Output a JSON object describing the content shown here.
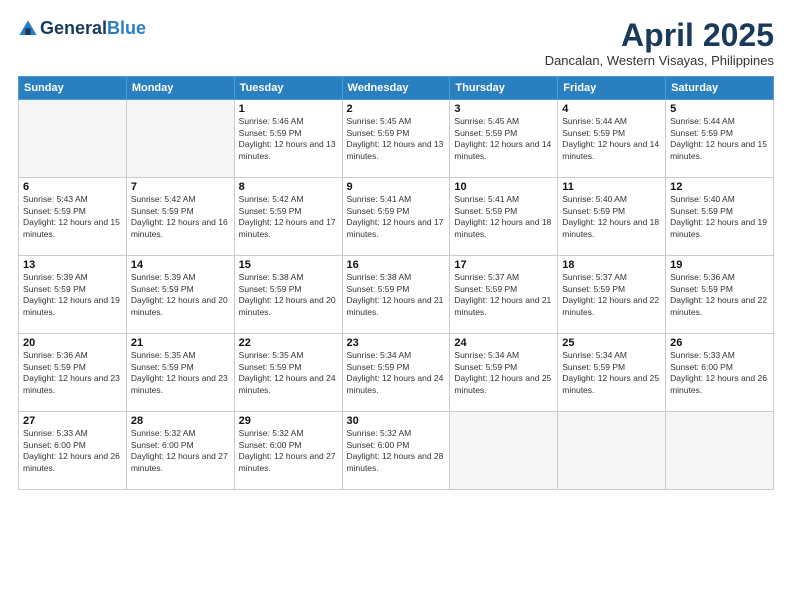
{
  "logo": {
    "general": "General",
    "blue": "Blue"
  },
  "title": "April 2025",
  "location": "Dancalan, Western Visayas, Philippines",
  "days_of_week": [
    "Sunday",
    "Monday",
    "Tuesday",
    "Wednesday",
    "Thursday",
    "Friday",
    "Saturday"
  ],
  "weeks": [
    [
      {
        "day": "",
        "empty": true
      },
      {
        "day": "",
        "empty": true
      },
      {
        "day": "1",
        "sunrise": "5:46 AM",
        "sunset": "5:59 PM",
        "daylight": "12 hours and 13 minutes."
      },
      {
        "day": "2",
        "sunrise": "5:45 AM",
        "sunset": "5:59 PM",
        "daylight": "12 hours and 13 minutes."
      },
      {
        "day": "3",
        "sunrise": "5:45 AM",
        "sunset": "5:59 PM",
        "daylight": "12 hours and 14 minutes."
      },
      {
        "day": "4",
        "sunrise": "5:44 AM",
        "sunset": "5:59 PM",
        "daylight": "12 hours and 14 minutes."
      },
      {
        "day": "5",
        "sunrise": "5:44 AM",
        "sunset": "5:59 PM",
        "daylight": "12 hours and 15 minutes."
      }
    ],
    [
      {
        "day": "6",
        "sunrise": "5:43 AM",
        "sunset": "5:59 PM",
        "daylight": "12 hours and 15 minutes."
      },
      {
        "day": "7",
        "sunrise": "5:42 AM",
        "sunset": "5:59 PM",
        "daylight": "12 hours and 16 minutes."
      },
      {
        "day": "8",
        "sunrise": "5:42 AM",
        "sunset": "5:59 PM",
        "daylight": "12 hours and 17 minutes."
      },
      {
        "day": "9",
        "sunrise": "5:41 AM",
        "sunset": "5:59 PM",
        "daylight": "12 hours and 17 minutes."
      },
      {
        "day": "10",
        "sunrise": "5:41 AM",
        "sunset": "5:59 PM",
        "daylight": "12 hours and 18 minutes."
      },
      {
        "day": "11",
        "sunrise": "5:40 AM",
        "sunset": "5:59 PM",
        "daylight": "12 hours and 18 minutes."
      },
      {
        "day": "12",
        "sunrise": "5:40 AM",
        "sunset": "5:59 PM",
        "daylight": "12 hours and 19 minutes."
      }
    ],
    [
      {
        "day": "13",
        "sunrise": "5:39 AM",
        "sunset": "5:59 PM",
        "daylight": "12 hours and 19 minutes."
      },
      {
        "day": "14",
        "sunrise": "5:39 AM",
        "sunset": "5:59 PM",
        "daylight": "12 hours and 20 minutes."
      },
      {
        "day": "15",
        "sunrise": "5:38 AM",
        "sunset": "5:59 PM",
        "daylight": "12 hours and 20 minutes."
      },
      {
        "day": "16",
        "sunrise": "5:38 AM",
        "sunset": "5:59 PM",
        "daylight": "12 hours and 21 minutes."
      },
      {
        "day": "17",
        "sunrise": "5:37 AM",
        "sunset": "5:59 PM",
        "daylight": "12 hours and 21 minutes."
      },
      {
        "day": "18",
        "sunrise": "5:37 AM",
        "sunset": "5:59 PM",
        "daylight": "12 hours and 22 minutes."
      },
      {
        "day": "19",
        "sunrise": "5:36 AM",
        "sunset": "5:59 PM",
        "daylight": "12 hours and 22 minutes."
      }
    ],
    [
      {
        "day": "20",
        "sunrise": "5:36 AM",
        "sunset": "5:59 PM",
        "daylight": "12 hours and 23 minutes."
      },
      {
        "day": "21",
        "sunrise": "5:35 AM",
        "sunset": "5:59 PM",
        "daylight": "12 hours and 23 minutes."
      },
      {
        "day": "22",
        "sunrise": "5:35 AM",
        "sunset": "5:59 PM",
        "daylight": "12 hours and 24 minutes."
      },
      {
        "day": "23",
        "sunrise": "5:34 AM",
        "sunset": "5:59 PM",
        "daylight": "12 hours and 24 minutes."
      },
      {
        "day": "24",
        "sunrise": "5:34 AM",
        "sunset": "5:59 PM",
        "daylight": "12 hours and 25 minutes."
      },
      {
        "day": "25",
        "sunrise": "5:34 AM",
        "sunset": "5:59 PM",
        "daylight": "12 hours and 25 minutes."
      },
      {
        "day": "26",
        "sunrise": "5:33 AM",
        "sunset": "6:00 PM",
        "daylight": "12 hours and 26 minutes."
      }
    ],
    [
      {
        "day": "27",
        "sunrise": "5:33 AM",
        "sunset": "6:00 PM",
        "daylight": "12 hours and 26 minutes."
      },
      {
        "day": "28",
        "sunrise": "5:32 AM",
        "sunset": "6:00 PM",
        "daylight": "12 hours and 27 minutes."
      },
      {
        "day": "29",
        "sunrise": "5:32 AM",
        "sunset": "6:00 PM",
        "daylight": "12 hours and 27 minutes."
      },
      {
        "day": "30",
        "sunrise": "5:32 AM",
        "sunset": "6:00 PM",
        "daylight": "12 hours and 28 minutes."
      },
      {
        "day": "",
        "empty": true
      },
      {
        "day": "",
        "empty": true
      },
      {
        "day": "",
        "empty": true
      }
    ]
  ],
  "labels": {
    "sunrise": "Sunrise:",
    "sunset": "Sunset:",
    "daylight": "Daylight:"
  }
}
